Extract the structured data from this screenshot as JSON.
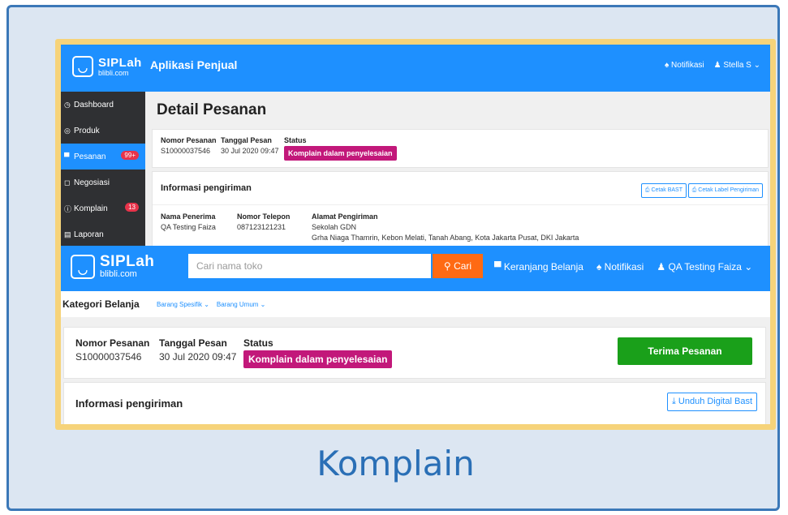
{
  "colors": {
    "brand_blue": "#1e90ff",
    "sidebar_dark": "#2f3033",
    "status_pink": "#c2187a",
    "cari_orange": "#ff6a13",
    "accept_green": "#1aa01a",
    "frame_gold": "#f6d37a",
    "caption_blue": "#2a6fb6"
  },
  "seller_app": {
    "logo_main": "SIPLah",
    "logo_sub": "blibli.com",
    "app_title": "Aplikasi Penjual",
    "notifikasi": "Notifikasi",
    "user": "Stella S",
    "sidebar": [
      {
        "label": "Dashboard",
        "icon": "dashboard-icon"
      },
      {
        "label": "Produk",
        "icon": "box-icon"
      },
      {
        "label": "Pesanan",
        "icon": "cart-icon",
        "badge": "99+"
      },
      {
        "label": "Negosiasi",
        "icon": "chat-icon"
      },
      {
        "label": "Komplain",
        "icon": "alert-icon",
        "badge": "13"
      },
      {
        "label": "Laporan",
        "icon": "report-icon"
      }
    ],
    "page_title": "Detail Pesanan",
    "order": {
      "nomor_label": "Nomor Pesanan",
      "nomor_value": "S10000037546",
      "tanggal_label": "Tanggal Pesan",
      "tanggal_value": "30 Jul 2020 09:47",
      "status_label": "Status",
      "status_value": "Komplain dalam penyelesaian"
    },
    "shipping": {
      "title": "Informasi pengiriman",
      "cetak_bast": "Cetak BAST",
      "cetak_label": "Cetak Label Pengiriman",
      "penerima_label": "Nama Penerima",
      "penerima_value": "QA Testing Faiza",
      "telepon_label": "Nomor Telepon",
      "telepon_value": "087123121231",
      "alamat_label": "Alamat Pengiriman",
      "alamat_line1": "Sekolah GDN",
      "alamat_line2": "Grha Niaga Thamrin, Kebon Melati, Tanah Abang, Kota Jakarta Pusat, DKI Jakarta"
    }
  },
  "buyer_app": {
    "logo_main": "SIPLah",
    "logo_sub": "blibli.com",
    "search_placeholder": "Cari nama toko",
    "cari": "Cari",
    "keranjang": "Keranjang Belanja",
    "notifikasi": "Notifikasi",
    "user": "QA Testing Faiza",
    "kategori": "Kategori Belanja",
    "barang_spesifik": "Barang Spesifik",
    "barang_umum": "Barang Umum",
    "order": {
      "nomor_label": "Nomor Pesanan",
      "nomor_value": "S10000037546",
      "tanggal_label": "Tanggal Pesan",
      "tanggal_value": "30 Jul 2020 09:47",
      "status_label": "Status",
      "status_value": "Komplain dalam penyelesaian"
    },
    "terima": "Terima Pesanan",
    "shipping_title": "Informasi pengiriman",
    "unduh": "Unduh Digital Bast"
  },
  "caption": "Komplain"
}
